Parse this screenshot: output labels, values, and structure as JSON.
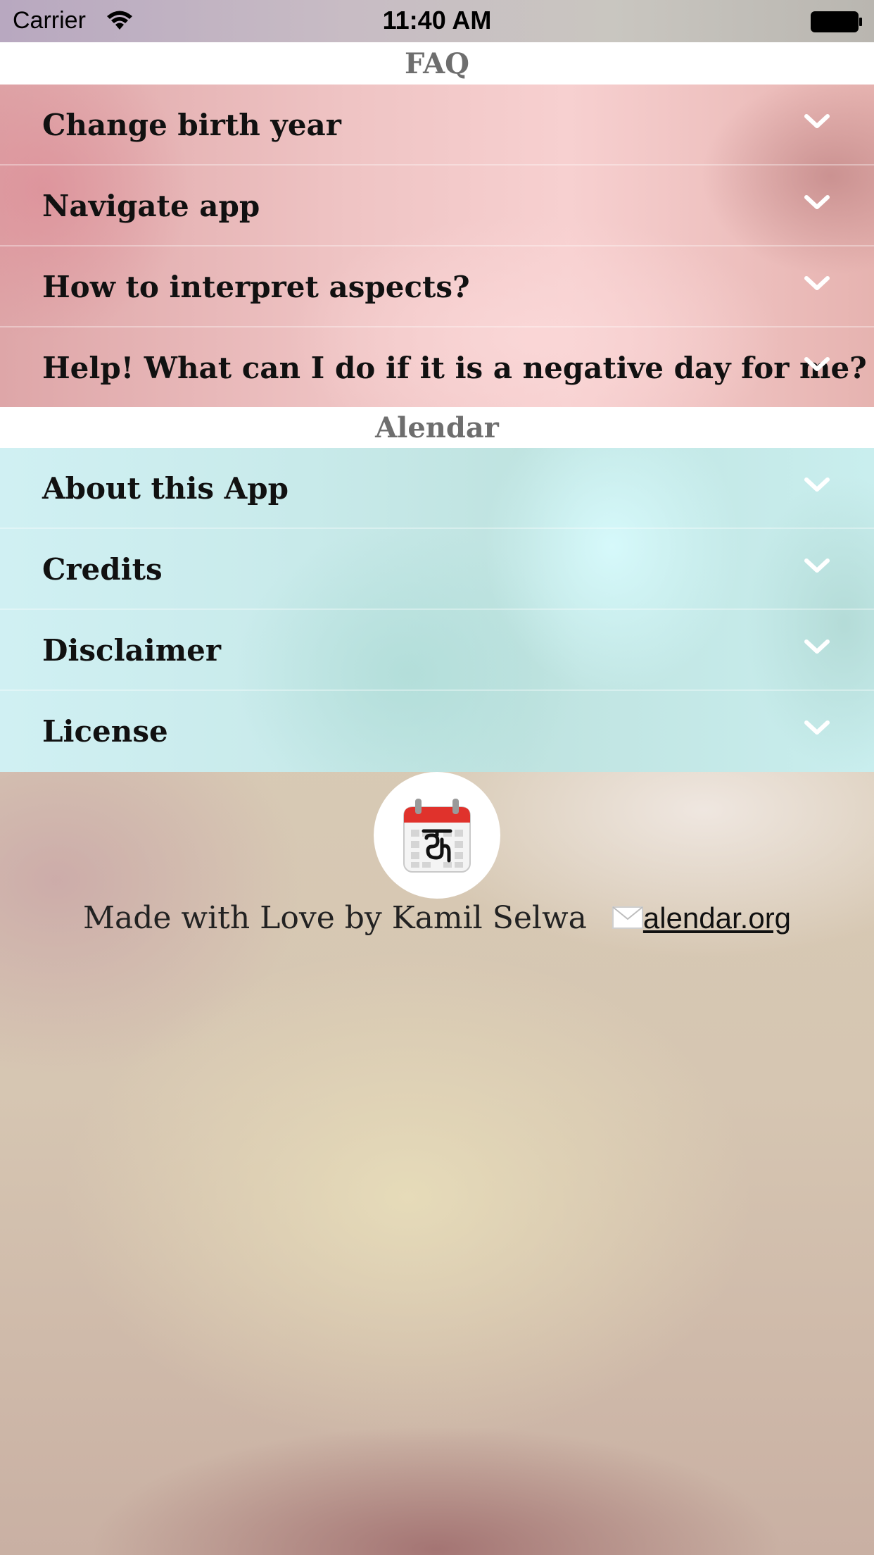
{
  "status_bar": {
    "carrier": "Carrier",
    "time": "11:40 AM",
    "wifi_icon": "wifi-icon",
    "battery_icon": "battery-full-icon"
  },
  "faq": {
    "header": "FAQ",
    "items": [
      {
        "label": "Change birth year",
        "icon": "chevron-down-icon"
      },
      {
        "label": "Navigate app",
        "icon": "chevron-down-icon"
      },
      {
        "label": "How to interpret aspects?",
        "icon": "chevron-down-icon"
      },
      {
        "label": "Help! What can I do if it is a negative day for me?",
        "icon": "chevron-down-icon"
      }
    ]
  },
  "alendar": {
    "header": "Alendar",
    "items": [
      {
        "label": "About this App",
        "icon": "chevron-down-icon"
      },
      {
        "label": "Credits",
        "icon": "chevron-down-icon"
      },
      {
        "label": "Disclaimer",
        "icon": "chevron-down-icon"
      },
      {
        "label": "License",
        "icon": "chevron-down-icon"
      }
    ]
  },
  "footer": {
    "logo_icon": "calendar-app-icon",
    "credit": "Made with Love by Kamil Selwa",
    "email_icon": "envelope-icon",
    "link": "alendar.org"
  },
  "colors": {
    "section_header_bg": "#ffffff",
    "section_header_text": "#6e6e6e",
    "row_text": "#111111",
    "chevron": "#ffffff",
    "calendar_red": "#e0322c"
  }
}
